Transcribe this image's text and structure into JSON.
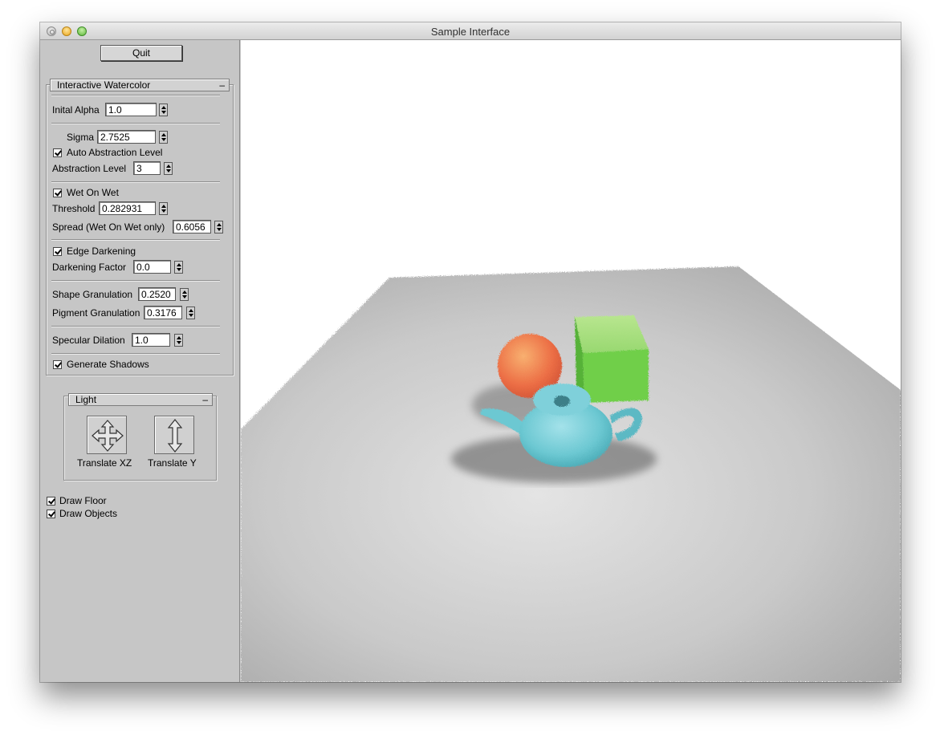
{
  "window": {
    "title": "Sample Interface"
  },
  "quit_label": "Quit",
  "watercolor": {
    "header": "Interactive Watercolor",
    "collapse": "–",
    "initial_alpha": {
      "label": "Inital Alpha",
      "value": "1.0"
    },
    "sigma": {
      "label": "Sigma",
      "value": "2.7525"
    },
    "auto_abstraction": {
      "label": "Auto Abstraction Level",
      "checked": true
    },
    "abstraction_level": {
      "label": "Abstraction Level",
      "value": "3"
    },
    "wet_on_wet": {
      "label": "Wet On Wet",
      "checked": true
    },
    "threshold": {
      "label": "Threshold",
      "value": "0.282931"
    },
    "spread": {
      "label": "Spread (Wet On Wet only)",
      "value": "0.6056"
    },
    "edge_darkening": {
      "label": "Edge Darkening",
      "checked": true
    },
    "darkening_factor": {
      "label": "Darkening Factor",
      "value": "0.0"
    },
    "shape_granulation": {
      "label": "Shape Granulation",
      "value": "0.2520"
    },
    "pigment_granulation": {
      "label": "Pigment Granulation",
      "value": "0.3176"
    },
    "specular_dilation": {
      "label": "Specular Dilation",
      "value": "1.0"
    },
    "generate_shadows": {
      "label": "Generate Shadows",
      "checked": true
    }
  },
  "light": {
    "header": "Light",
    "collapse": "–",
    "translate_xz": "Translate XZ",
    "translate_y": "Translate Y"
  },
  "draw_floor": {
    "label": "Draw Floor",
    "checked": true
  },
  "draw_objects": {
    "label": "Draw Objects",
    "checked": true
  },
  "scene": {
    "background": "#ffffff",
    "floor_color": "#bdbdbd",
    "sphere_color": "#f07a4a",
    "cube_color": "#6fcf4a",
    "teapot_color": "#6cc8d2"
  }
}
